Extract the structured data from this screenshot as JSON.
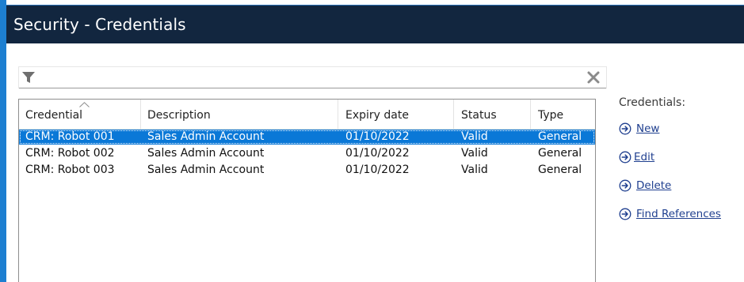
{
  "window": {
    "title": "Security - Credentials"
  },
  "filter": {
    "value": "",
    "icon": "filter-icon",
    "clear_icon": "close-icon"
  },
  "grid": {
    "columns": [
      "Credential",
      "Description",
      "Expiry date",
      "Status",
      "Type"
    ],
    "sorted_column": "Credential",
    "rows": [
      {
        "credential": "CRM: Robot 001",
        "description": "Sales Admin Account",
        "expiry": "01/10/2022",
        "status": "Valid",
        "type": "General",
        "selected": true
      },
      {
        "credential": "CRM: Robot 002",
        "description": "Sales Admin Account",
        "expiry": "01/10/2022",
        "status": "Valid",
        "type": "General",
        "selected": false
      },
      {
        "credential": "CRM: Robot 003",
        "description": "Sales Admin Account",
        "expiry": "01/10/2022",
        "status": "Valid",
        "type": "General",
        "selected": false
      }
    ]
  },
  "actions": {
    "title": "Credentials:",
    "items": [
      {
        "label": "New",
        "icon": "arrow-right-circle-icon"
      },
      {
        "label": "Edit",
        "icon": "arrow-right-circle-icon"
      },
      {
        "label": "Delete",
        "icon": "arrow-right-circle-icon"
      },
      {
        "label": "Find References",
        "icon": "arrow-right-circle-icon"
      }
    ]
  },
  "colors": {
    "titlebar": "#12263f",
    "accent_edge": "#1d7fd1",
    "selection": "#0a78d7",
    "link": "#1f3f8f"
  }
}
